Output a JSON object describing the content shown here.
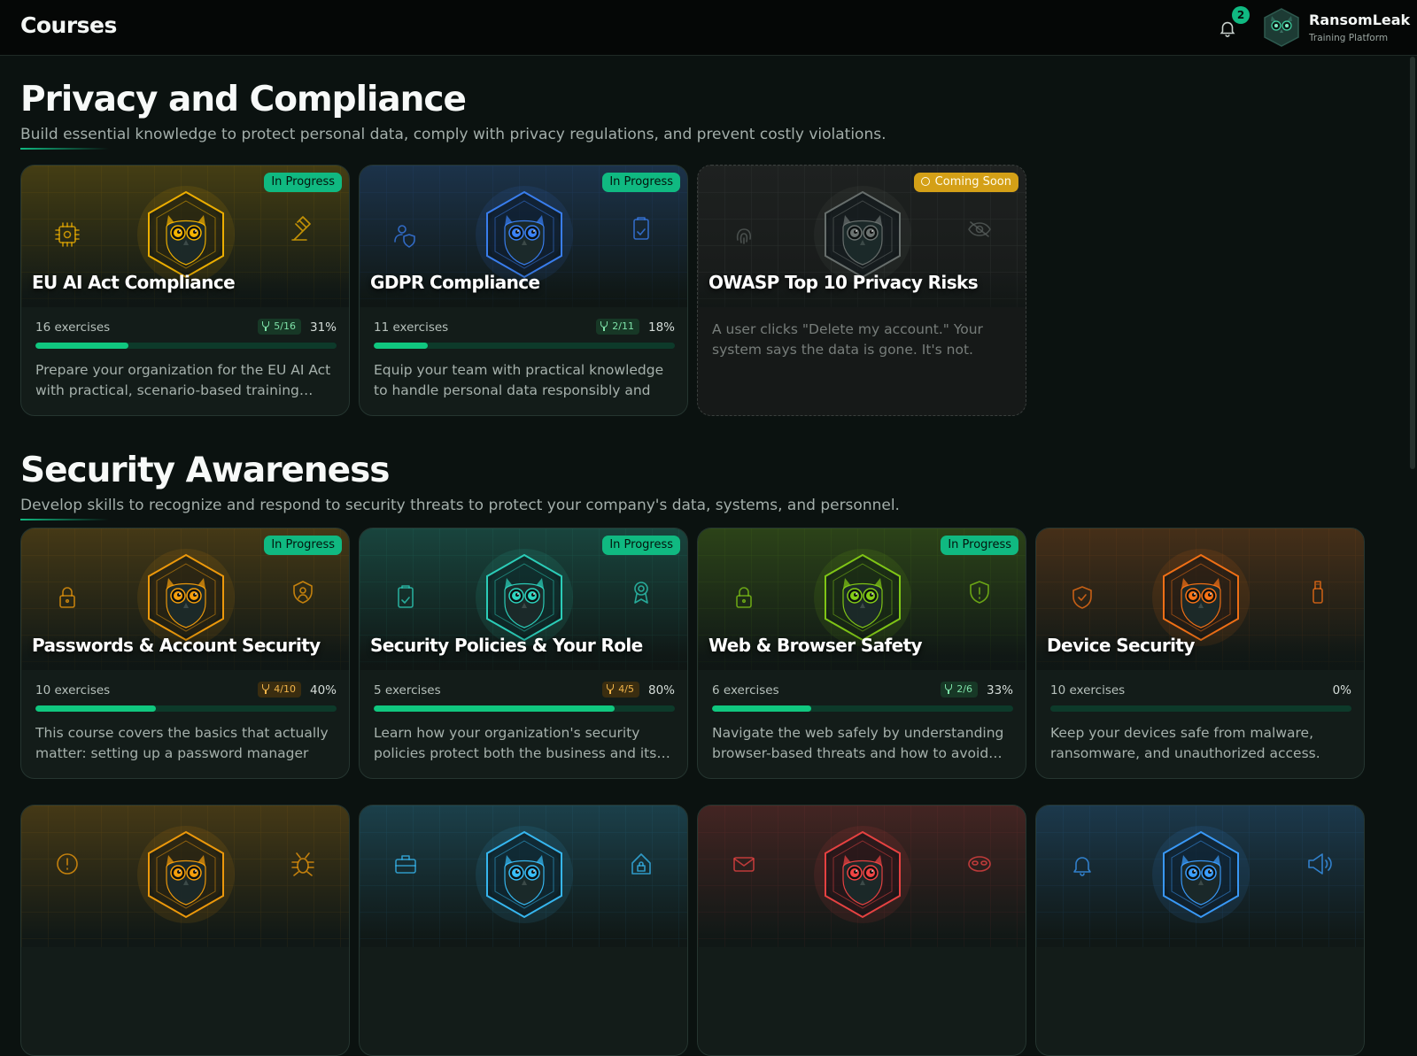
{
  "header": {
    "title": "Courses",
    "notifications_count": "2",
    "brand_name": "RansomLeak",
    "brand_subtitle": "Training Platform"
  },
  "sections": [
    {
      "title": "Privacy and Compliance",
      "description": "Build essential knowledge to protect personal data, comply with privacy regulations, and prevent costly violations.",
      "courses": [
        {
          "title": "EU AI Act Compliance",
          "status": "In Progress",
          "exercises": "16 exercises",
          "trophy": "5/16",
          "percent": "31%",
          "progress": 0.31,
          "description": "Prepare your organization for the EU AI Act with practical, scenario-based training…",
          "accent": "#f5b400",
          "icons": [
            "chip-icon",
            "gavel-icon"
          ]
        },
        {
          "title": "GDPR Compliance",
          "status": "In Progress",
          "exercises": "11 exercises",
          "trophy": "2/11",
          "percent": "18%",
          "progress": 0.18,
          "description": "Equip your team with practical knowledge to handle personal data responsibly and stay…",
          "accent": "#3b82f6",
          "icons": [
            "user-shield-icon",
            "clipboard-check-icon"
          ]
        },
        {
          "title": "OWASP Top 10 Privacy Risks",
          "status": "Coming Soon",
          "description": "A user clicks \"Delete my account.\" Your system says the data is gone. It's not. Their…",
          "accent": "#6b7280",
          "icons": [
            "fingerprint-icon",
            "eye-off-icon"
          ]
        }
      ]
    },
    {
      "title": "Security Awareness",
      "description": "Develop skills to recognize and respond to security threats to protect your company's data, systems, and personnel.",
      "courses": [
        {
          "title": "Passwords & Account Security",
          "status": "In Progress",
          "exercises": "10 exercises",
          "trophy": "4/10",
          "percent": "40%",
          "progress": 0.4,
          "description": "This course covers the basics that actually matter: setting up a password manager so…",
          "accent": "#f59e0b",
          "icons": [
            "lock-icon",
            "user-badge-icon"
          ]
        },
        {
          "title": "Security Policies & Your Role",
          "status": "In Progress",
          "exercises": "5 exercises",
          "trophy": "4/5",
          "percent": "80%",
          "progress": 0.8,
          "description": "Learn how your organization's security policies protect both the business and its…",
          "accent": "#2dd4bf",
          "icons": [
            "clipboard-check-icon",
            "award-icon"
          ]
        },
        {
          "title": "Web & Browser Safety",
          "status": "In Progress",
          "exercises": "6 exercises",
          "trophy": "2/6",
          "percent": "33%",
          "progress": 0.33,
          "description": "Navigate the web safely by understanding browser-based threats and how to avoid…",
          "accent": "#84cc16",
          "icons": [
            "lock-icon",
            "shield-alert-icon"
          ]
        },
        {
          "title": "Device Security",
          "exercises": "10 exercises",
          "percent": "0%",
          "progress": 0,
          "description": "Keep your devices safe from malware, ransomware, and unauthorized access. This…",
          "accent": "#f97316",
          "icons": [
            "shield-check-icon",
            "usb-icon"
          ]
        }
      ]
    }
  ],
  "row3_cards": [
    {
      "accent": "#f59e0b",
      "icons": [
        "alert-circle-icon",
        "bug-icon"
      ]
    },
    {
      "accent": "#38bdf8",
      "icons": [
        "briefcase-icon",
        "house-lock-icon"
      ]
    },
    {
      "accent": "#ef4444",
      "icons": [
        "mail-icon",
        "mask-icon"
      ]
    },
    {
      "accent": "#3b9eff",
      "icons": [
        "bell-icon",
        "megaphone-icon"
      ]
    }
  ]
}
